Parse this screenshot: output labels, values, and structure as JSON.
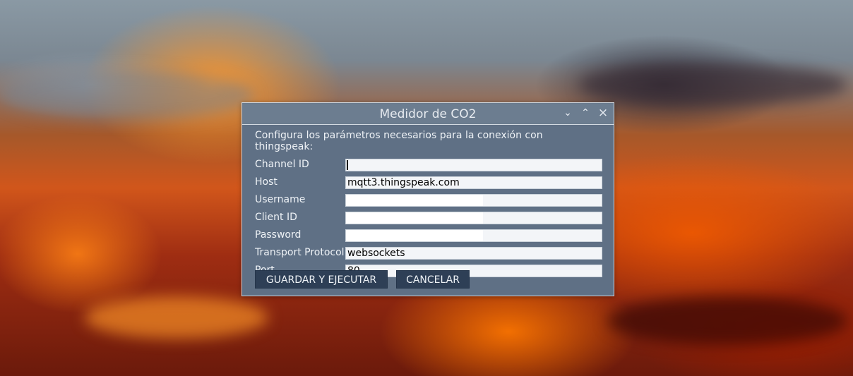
{
  "window": {
    "title": "Medidor de CO2",
    "controls": [
      {
        "name": "minimize",
        "glyph": "⌄"
      },
      {
        "name": "maximize",
        "glyph": "⌃"
      },
      {
        "name": "close",
        "glyph": "×"
      }
    ]
  },
  "form": {
    "intro": "Configura los parámetros necesarios para la conexión con thingspeak:",
    "fields": [
      {
        "label": "Channel ID",
        "value": ""
      },
      {
        "label": "Host",
        "value": "mqtt3.thingspeak.com"
      },
      {
        "label": "Username",
        "value": ""
      },
      {
        "label": "Client ID",
        "value": ""
      },
      {
        "label": "Password",
        "value": ""
      },
      {
        "label": "Transport Protocol",
        "value": "websockets"
      },
      {
        "label": "Port",
        "value": "80"
      }
    ]
  },
  "buttons": {
    "save": "GUARDAR Y EJECUTAR",
    "cancel": "CANCELAR"
  }
}
